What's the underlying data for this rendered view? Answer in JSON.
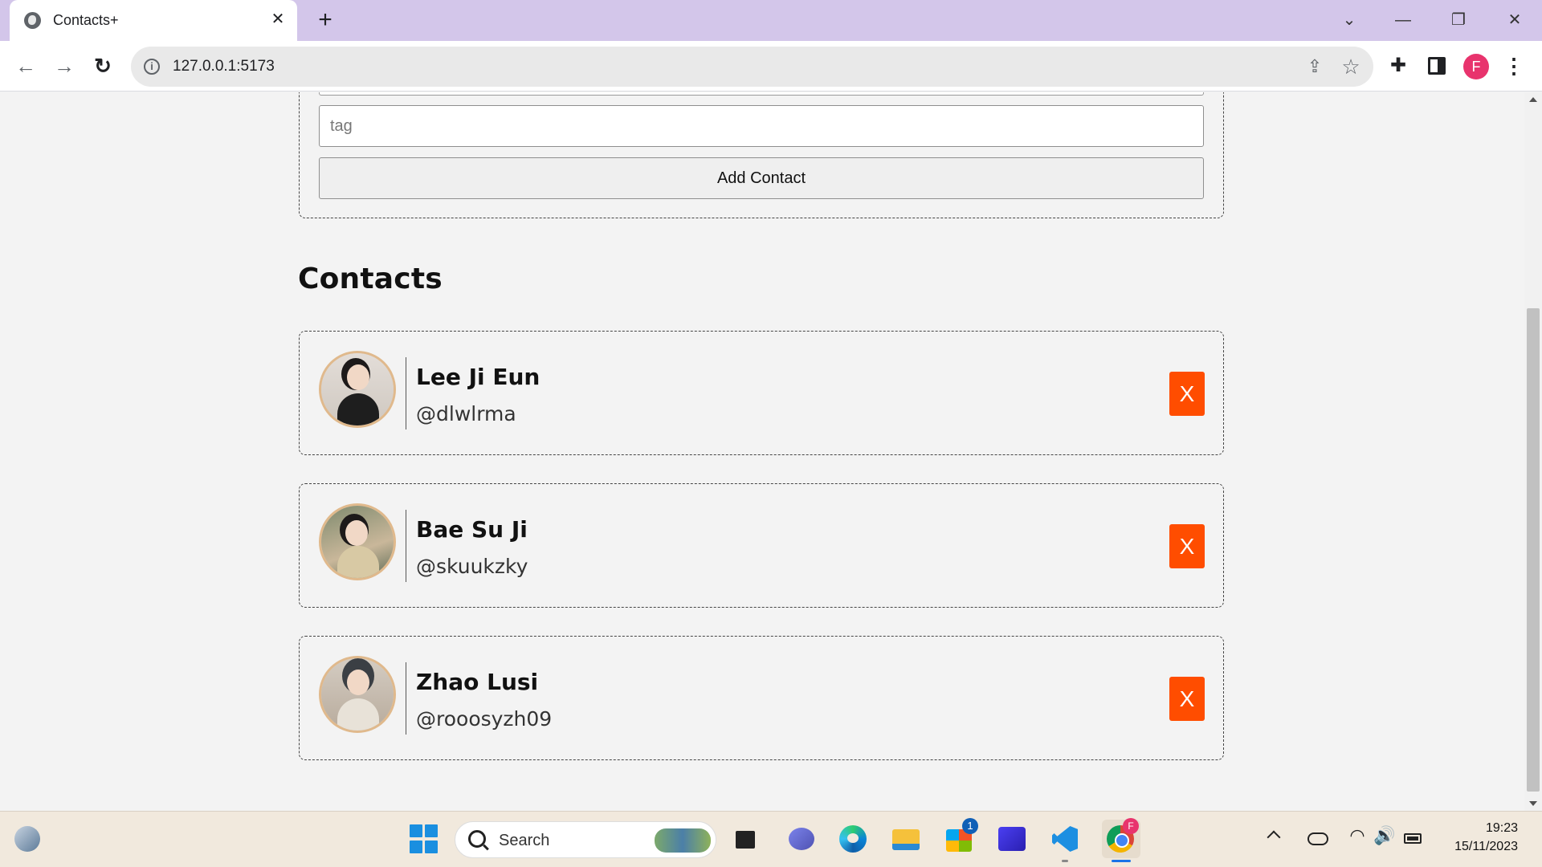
{
  "browser": {
    "tab_title": "Contacts+",
    "tab_close": "✕",
    "new_tab": "+",
    "url": "127.0.0.1:5173",
    "profile_initial": "F"
  },
  "form": {
    "tag_placeholder": "tag",
    "add_button_label": "Add Contact"
  },
  "contacts": {
    "heading": "Contacts",
    "delete_label": "X",
    "items": [
      {
        "name": "Lee Ji Eun",
        "handle": "@dlwlrma"
      },
      {
        "name": "Bae Su Ji",
        "handle": "@skuukzky"
      },
      {
        "name": "Zhao Lusi",
        "handle": "@rooosyzh09"
      }
    ]
  },
  "taskbar": {
    "search_placeholder": "Search",
    "store_badge": "1",
    "chrome_badge": "F",
    "time": "19:23",
    "date": "15/11/2023"
  },
  "colors": {
    "delete_button": "#ff4d00",
    "avatar_ring": "#e0b98c",
    "tabstrip": "#d3c6ea",
    "page_bg": "#f3f3f3"
  }
}
